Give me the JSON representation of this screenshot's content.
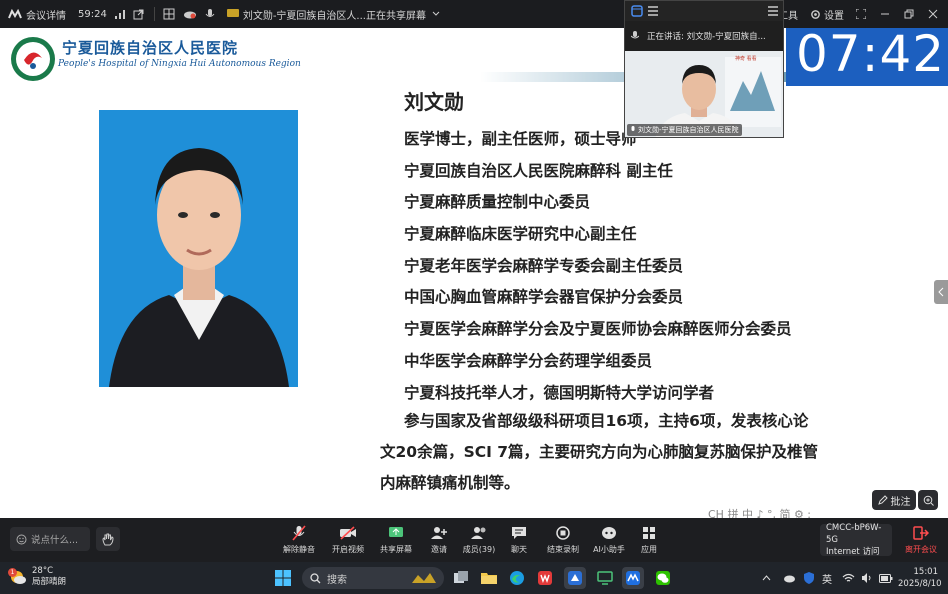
{
  "topbar": {
    "app_name": "会议详情",
    "timer": "59:24",
    "share_title": "刘文勋-宁夏回族自治区人...正在共享屏幕",
    "tools_label": "工具",
    "settings_label": "设置"
  },
  "slide": {
    "hospital_cn": "宁夏回族自治区人民医院",
    "hospital_en": "People's Hospital of Ningxia Hui Autonomous Region",
    "name": "刘文勋",
    "lines": [
      "医学博士，副主任医师，硕士导师",
      "宁夏回族自治区人民医院麻醉科 副主任",
      "宁夏麻醉质量控制中心委员",
      "宁夏麻醉临床医学研究中心副主任",
      "宁夏老年医学会麻醉学专委会副主任委员",
      "中国心胸血管麻醉学会器官保护分会委员",
      "宁夏医学会麻醉学分会及宁夏医师协会麻醉医师分会委员",
      "中华医学会麻醉学分会药理学组委员",
      "宁夏科技托举人才，德国明斯特大学访问学者"
    ],
    "paragraph": [
      "参与国家及省部级级科研项目16项，主持6项，发表核心论",
      "文20余篇，SCI 7篇，主要研究方向为心肺脑复苏脑保护及椎管",
      "内麻醉镇痛机制等。"
    ],
    "ime_text": "CH 拼 中 ♪ °, 简 ⚙ :",
    "annotate_label": "批注"
  },
  "video": {
    "speaking_label": "正在讲话: 刘文勋-宁夏回族自...",
    "participant_label": "刘文勋-宁夏回族自治区人民医院",
    "poster_text": "神奇 看看"
  },
  "clock": {
    "time": "07:42"
  },
  "meeting_bar": {
    "chat_placeholder": "说点什么...",
    "controls": [
      {
        "label": "解除静音"
      },
      {
        "label": "开启视频"
      },
      {
        "label": "共享屏幕"
      },
      {
        "label": "邀请"
      },
      {
        "label": "成员(39)"
      },
      {
        "label": "聊天"
      },
      {
        "label": "结束录制"
      },
      {
        "label": "AI小助手"
      },
      {
        "label": "应用"
      }
    ],
    "network_name": "CMCC-bP6W-5G",
    "network_status": "Internet 访问",
    "leave_label": "离开会议"
  },
  "taskbar": {
    "weather_temp": "28°C",
    "weather_desc": "局部晴朗",
    "weather_badge": "1",
    "search_label": "搜索",
    "ime_lang": "英",
    "time": "15:01",
    "date": "2025/8/10"
  },
  "colors": {
    "clock_bg": "#1c5fbf",
    "leave_red": "#ff4d4f",
    "photo_bg": "#1f8fd8",
    "hospital_blue": "#1a5a9a"
  }
}
